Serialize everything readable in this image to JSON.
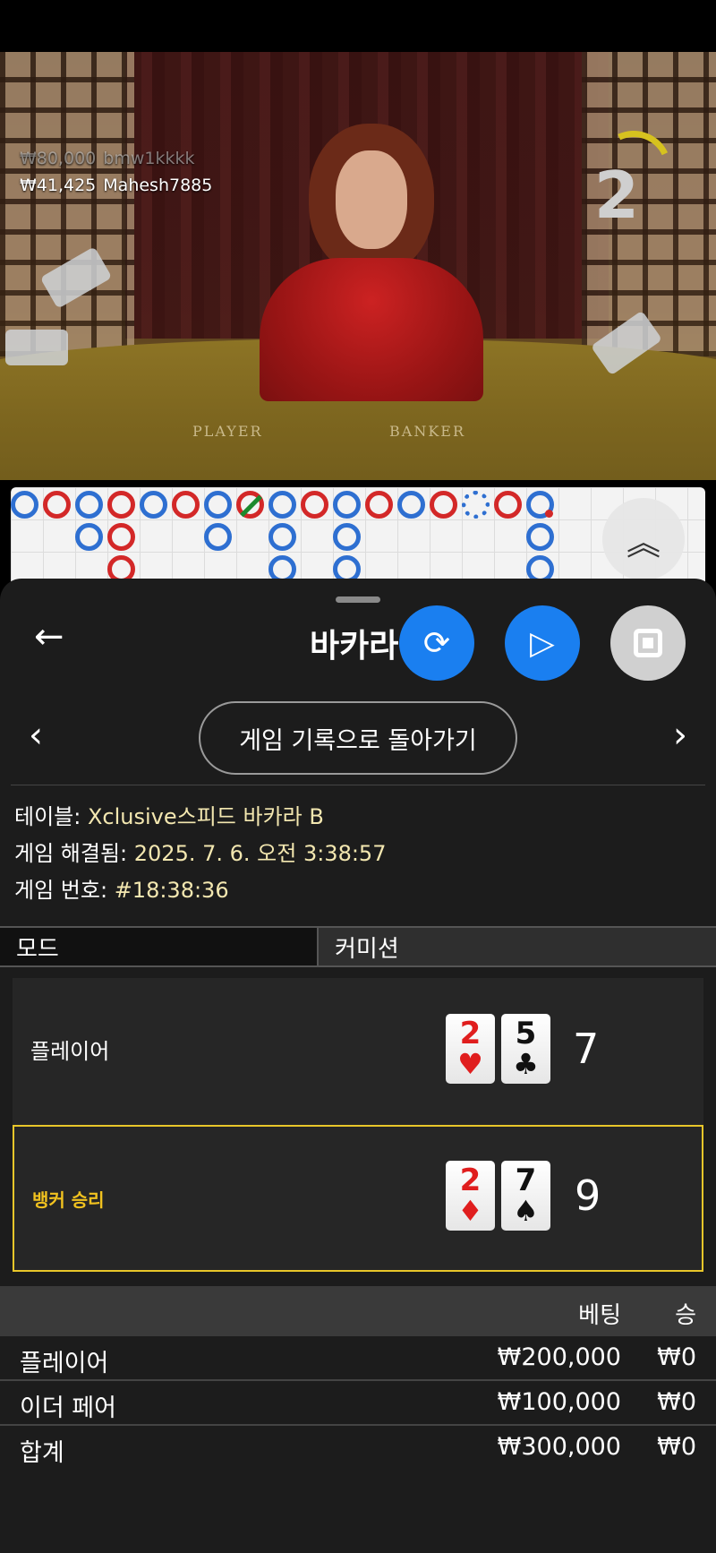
{
  "video": {
    "ticker": [
      {
        "amount": "₩80,000",
        "user": "bmw1kkkk"
      },
      {
        "amount": "₩41,425",
        "user": "Mahesh7885"
      }
    ],
    "timer": "2",
    "table_player_label": "PLAYER",
    "table_banker_label": "BANKER"
  },
  "roadmap": {
    "colors": {
      "player": "#2e6fd1",
      "banker": "#d32828",
      "tie": "#1c8a2e"
    }
  },
  "sheet": {
    "title": "바카라",
    "back_history_label": "게임 기록으로 돌아가기",
    "info": {
      "table_key": "테이블:",
      "table_value": "Xclusive스피드 바카라 B",
      "resolved_key": "게임 해결됨:",
      "resolved_value": "2025. 7. 6. 오전 3:38:57",
      "number_key": "게임 번호:",
      "number_value": "#18:38:36"
    },
    "mode_key": "모드",
    "mode_value": "커미션",
    "player": {
      "label": "플레이어",
      "cards": [
        {
          "rank": "2",
          "suit": "♥"
        },
        {
          "rank": "5",
          "suit": "♣"
        }
      ],
      "score": "7"
    },
    "banker": {
      "label": "뱅커 승리",
      "cards": [
        {
          "rank": "2",
          "suit": "♦"
        },
        {
          "rank": "7",
          "suit": "♠"
        }
      ],
      "score": "9"
    },
    "bets": {
      "header_bet": "베팅",
      "header_win": "승",
      "rows": [
        {
          "label": "플레이어",
          "amount": "₩200,000",
          "win": "₩0"
        },
        {
          "label": "이더 페어",
          "amount": "₩100,000",
          "win": "₩0"
        },
        {
          "label": "합계",
          "amount": "₩300,000",
          "win": "₩0"
        }
      ]
    }
  }
}
